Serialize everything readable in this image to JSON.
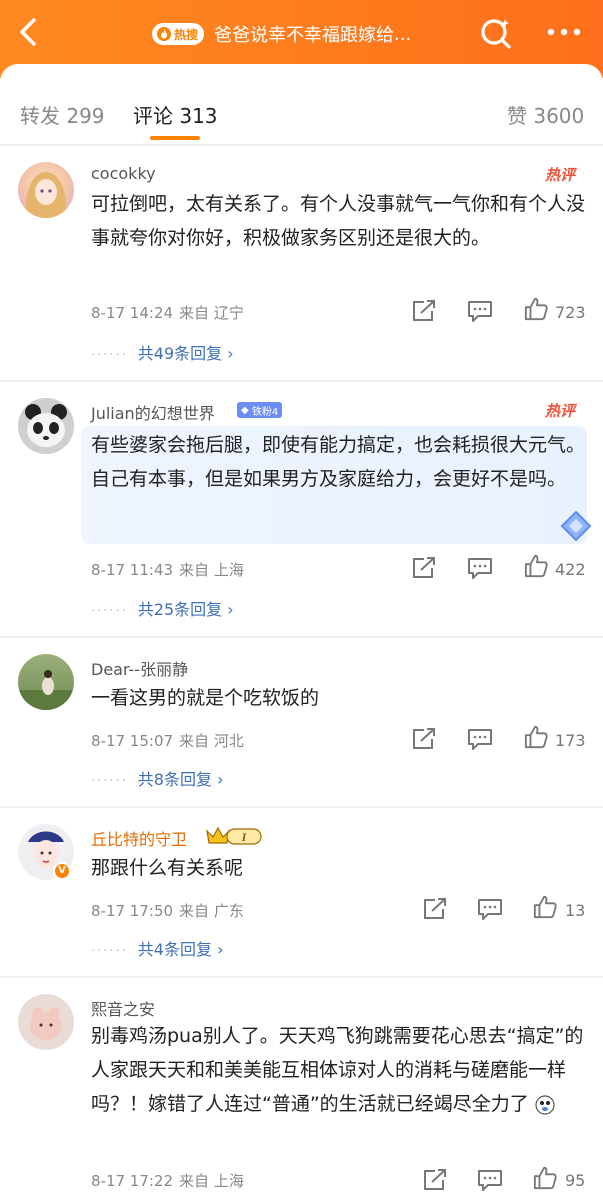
{
  "header": {
    "hot_badge": "热搜",
    "topic": "爸爸说幸不幸福跟嫁给",
    "topic_suffix": "..."
  },
  "tabs": {
    "forward": "转发 299",
    "comment": "评论 313",
    "like": "赞 3600"
  },
  "comments": [
    {
      "user": "cocokky",
      "hot": "热评",
      "text": "可拉倒吧，太有关系了。有个人没事就气一气你和有个人没事就夸你对你好，积极做家务区别还是很大的。",
      "date": "8-17 14:24",
      "location": "来自 辽宁",
      "likes": "723",
      "replies": "共49条回复 ›"
    },
    {
      "user": "Julian的幻想世界",
      "fan_badge": "铁粉4",
      "hot": "热评",
      "text": "有些婆家会拖后腿，即使有能力搞定，也会耗损很大元气。自己有本事，但是如果男方及家庭给力，会更好不是吗。",
      "date": "8-17 11:43",
      "location": "来自 上海",
      "likes": "422",
      "replies": "共25条回复 ›"
    },
    {
      "user": "Dear--张丽静",
      "text": "一看这男的就是个吃软饭的",
      "date": "8-17 15:07",
      "location": "来自 河北",
      "likes": "173",
      "replies": "共8条回复 ›"
    },
    {
      "user": "丘比特的守卫",
      "vip_level": "I",
      "verify": "V",
      "text": "那跟什么有关系呢",
      "date": "8-17 17:50",
      "location": "来自 广东",
      "likes": "13",
      "replies": "共4条回复 ›"
    },
    {
      "user": "熙音之安",
      "text": "别毒鸡汤pua别人了。天天鸡飞狗跳需要花心思去“搞定”的人家跟天天和和美美能互相体谅对人的消耗与磋磨能一样吗？！嫁错了人连过“普通”的生活就已经竭尽全力了",
      "date": "8-17 17:22",
      "location": "来自 上海",
      "likes": "95"
    }
  ],
  "colors": {
    "header": "#ff7a1d",
    "accent": "#ff8200",
    "link": "#3f6fb6",
    "hot": "#f0533a"
  }
}
